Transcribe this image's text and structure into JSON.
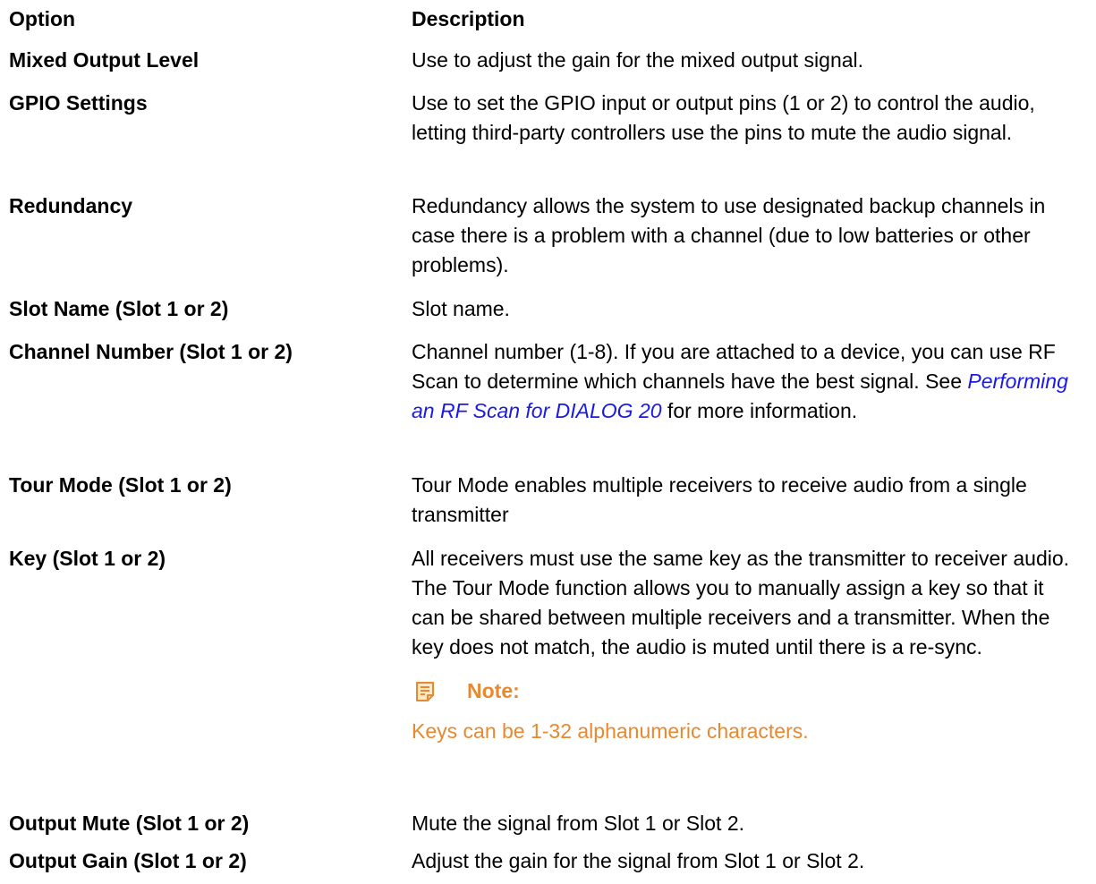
{
  "header": {
    "option": "Option",
    "description": "Description"
  },
  "rows": [
    {
      "option": "Mixed Output Level",
      "description": "Use to adjust the gain for the mixed output signal."
    },
    {
      "option": "GPIO Settings",
      "description": "Use to set the GPIO input or output pins (1 or 2) to control the audio, letting third-party controllers use the pins to mute the audio signal."
    },
    {
      "option": "Redundancy",
      "description": "Redundancy allows the system to use designated backup channels in case there is a problem with a channel (due to low batteries or other problems)."
    },
    {
      "option": "Slot Name (Slot 1 or 2)",
      "description": "Slot name."
    },
    {
      "option": "Channel Number (Slot 1 or 2)",
      "description_before": "Channel number (1-8). If you are attached to a device, you can use RF Scan to determine which channels have the best signal. See ",
      "description_link": "Performing an RF Scan for DIALOG 20",
      "description_after": " for more information."
    },
    {
      "option": "Tour Mode (Slot 1 or 2)",
      "description": "Tour Mode enables multiple receivers to receive audio from a single transmitter"
    },
    {
      "option": "Key (Slot 1 or 2)",
      "description": "All receivers must use the same key as the transmitter to receiver audio. The Tour Mode function allows you to manually assign a key so that it can be shared between multiple receivers and a transmitter. When the key does not match, the audio is muted until there is a re-sync.",
      "note_title": "Note:",
      "note_body": "Keys can be 1-32 alphanumeric characters.",
      "note_icon": "note-icon"
    },
    {
      "option": "Output Mute (Slot 1 or 2)",
      "description": "Mute the signal from Slot 1 or Slot 2."
    },
    {
      "option": "Output Gain (Slot 1 or 2)",
      "description": "Adjust the gain for the signal from Slot 1 or Slot 2."
    }
  ],
  "colors": {
    "link": "#1a1ae6",
    "note": "#e8892f"
  }
}
